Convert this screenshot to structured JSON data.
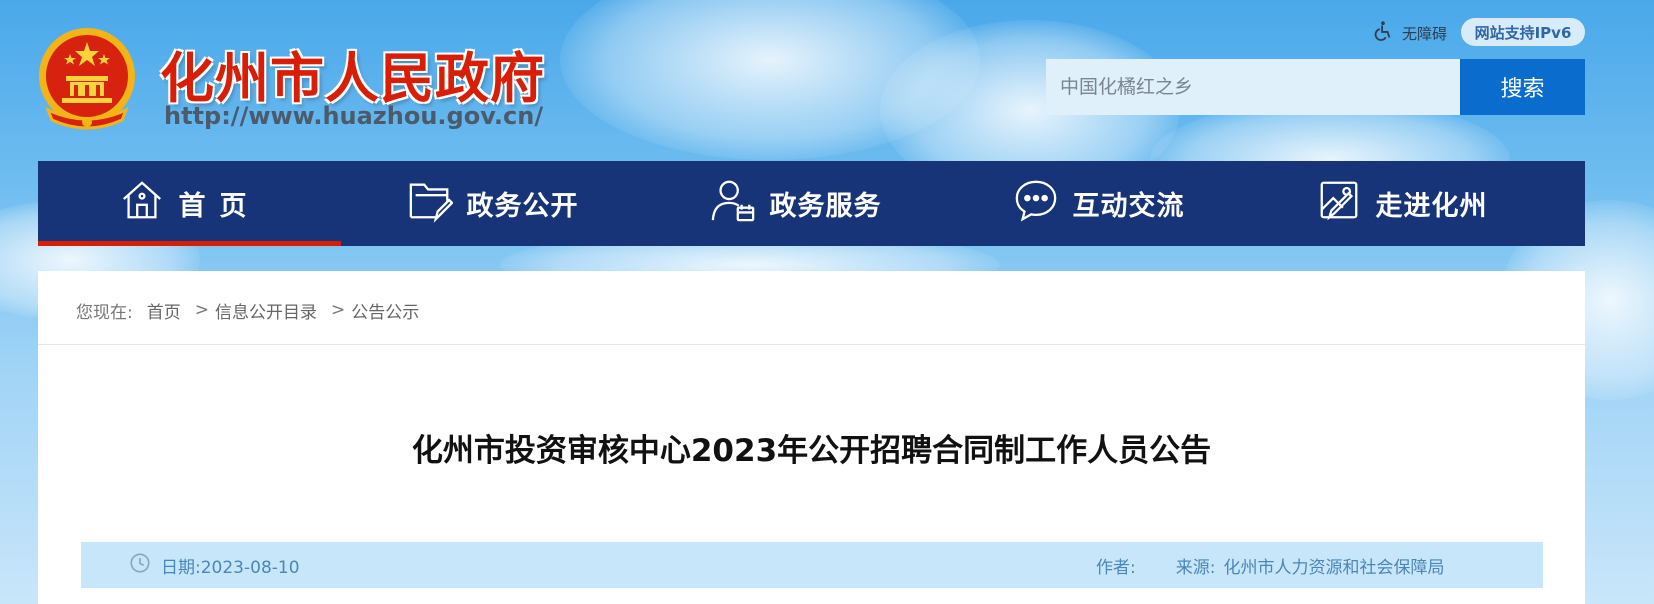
{
  "header": {
    "site_title": "化州市人民政府",
    "site_url": "http://www.huazhou.gov.cn/",
    "accessibility_label": "无障碍",
    "ipv6_badge": "网站支持IPv6",
    "search": {
      "placeholder": "中国化橘红之乡",
      "button_label": "搜索"
    }
  },
  "nav": {
    "items": [
      {
        "label": "首页",
        "icon": "home-icon",
        "active": true
      },
      {
        "label": "政务公开",
        "icon": "folder-edit-icon"
      },
      {
        "label": "政务服务",
        "icon": "user-calendar-icon"
      },
      {
        "label": "互动交流",
        "icon": "chat-bubble-icon"
      },
      {
        "label": "走进化州",
        "icon": "picture-edit-icon"
      }
    ]
  },
  "breadcrumb": {
    "prefix": "您现在:",
    "items": [
      "首页",
      "信息公开目录",
      "公告公示"
    ]
  },
  "article": {
    "title": "化州市投资审核中心2023年公开招聘合同制工作人员公告",
    "date_label": "日期:",
    "date": "2023-08-10",
    "author_label": "作者:",
    "source_label": "来源:",
    "source": "化州市人力资源和社会保障局"
  },
  "colors": {
    "nav_bg": "#163477",
    "active_underline": "#d81e06",
    "search_button": "#0a6ccc",
    "title_red": "#d81e06",
    "meta_bar": "#c8e6fa",
    "meta_text": "#4a86b8"
  }
}
